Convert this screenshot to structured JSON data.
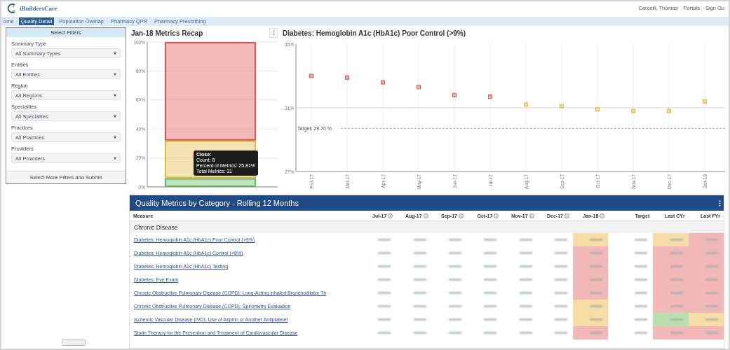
{
  "header": {
    "logo_text": "iBuildersCare",
    "user_links": [
      "Carcelli, Thomas",
      "Portals",
      "Sign Ou"
    ]
  },
  "nav": [
    {
      "label": "ome",
      "selected": false
    },
    {
      "label": "Quality Detail",
      "selected": true
    },
    {
      "label": "Population Overlap",
      "selected": false
    },
    {
      "label": "Pharmacy QPR",
      "selected": false
    },
    {
      "label": "Pharmacy Prescribing",
      "selected": false
    }
  ],
  "filters": {
    "title": "Select Filters",
    "fields": [
      {
        "label": "Summary Type",
        "value": "All Summary Types"
      },
      {
        "label": "Entities",
        "value": "All Entities"
      },
      {
        "label": "Region",
        "value": "All Regions"
      },
      {
        "label": "Specialties",
        "value": "All Specialties"
      },
      {
        "label": "Practices",
        "value": "All Practices"
      },
      {
        "label": "Providers",
        "value": "All Providers"
      }
    ],
    "submit": "Select More Filters and Submit"
  },
  "recap": {
    "title": "Jan-18 Metrics Recap",
    "chart_data": {
      "type": "bar",
      "stacked": true,
      "grid": true,
      "ylim": [
        0,
        100
      ],
      "yticks": [
        {
          "value": 0,
          "label": "0%"
        },
        {
          "value": 20,
          "label": "20%"
        },
        {
          "value": 40,
          "label": "40%"
        },
        {
          "value": 60,
          "label": "60%"
        },
        {
          "value": 80,
          "label": "80%"
        },
        {
          "value": 100,
          "label": "100%"
        }
      ],
      "series": [
        {
          "color": "#5cb85c",
          "values": [
            6
          ]
        },
        {
          "color": "#e6b73c",
          "values": [
            26
          ]
        },
        {
          "color": "#d9534f",
          "values": [
            68
          ]
        }
      ]
    },
    "tooltip": {
      "title": "Close:",
      "lines": [
        "Count: 8",
        "Percent of Metrics: 25.81%",
        "Total Metrics: 31"
      ]
    }
  },
  "trend": {
    "title": "Diabetes: Hemoglobin A1c (HbA1c) Poor Control (>9%)",
    "chart_data": {
      "type": "scatter",
      "grid": "x",
      "categories": [
        "Feb-17",
        "Mar-17",
        "Apr-17",
        "May-17",
        "Jun-17",
        "Jul-17",
        "Aug-17",
        "Sep-17",
        "Oct-17",
        "Nov-17",
        "Dec-17",
        "Jan-18"
      ],
      "ylim": [
        27,
        35
      ],
      "yticks": [
        {
          "value": 27,
          "label": "27%"
        },
        {
          "value": 31,
          "label": "31%"
        },
        {
          "value": 35,
          "label": "35%"
        }
      ],
      "series": [
        {
          "color": "#d9534f",
          "values": [
            33.0,
            32.9,
            32.6,
            32.3,
            31.8,
            31.7,
            null,
            null,
            null,
            null,
            null,
            null
          ]
        },
        {
          "color": "#e6b73c",
          "values": [
            null,
            null,
            null,
            null,
            null,
            null,
            31.2,
            31.1,
            30.9,
            30.8,
            30.8,
            31.4
          ]
        }
      ],
      "ref_lines": [
        {
          "axis": "y",
          "value": 31
        },
        {
          "axis": "y",
          "value": 29.7,
          "label": "Target: 29.70 %"
        }
      ]
    }
  },
  "table": {
    "title": "Quality Metrics by Category - Rolling 12 Months",
    "columns": [
      {
        "label": "Measure",
        "info": false
      },
      {
        "label": "Jul-17",
        "info": true
      },
      {
        "label": "Aug-17",
        "info": true
      },
      {
        "label": "Sep-17",
        "info": true
      },
      {
        "label": "Oct-17",
        "info": true
      },
      {
        "label": "Nov-17",
        "info": true
      },
      {
        "label": "Dec-17",
        "info": true
      },
      {
        "label": "Jan-18",
        "info": true
      },
      {
        "label": "Target",
        "info": false
      },
      {
        "label": "Last CYr",
        "info": false
      },
      {
        "label": "Last FYr",
        "info": false
      }
    ],
    "section": "Chronic Disease",
    "rows": [
      {
        "measure": "Diabetes: Hemoglobin A1c (HbA1c) Poor Control (>9%)",
        "highlights": [
          {
            "color": "#f8dca6"
          },
          {
            "color": "#f8dca6"
          },
          {
            "color": "#f2b8b8"
          }
        ]
      },
      {
        "measure": "Diabetes: Hemoglobin A1c (HbA1c) Control (<8%)",
        "highlights": [
          {
            "color": "#f2b8b8"
          },
          {
            "color": "#f2b8b8"
          },
          {
            "color": "#f2b8b8"
          }
        ]
      },
      {
        "measure": "Diabetes: Hemoglobin A1c (HbA1c) Testing",
        "highlights": [
          {
            "color": "#f2b8b8"
          },
          {
            "color": "#f2b8b8"
          },
          {
            "color": "#f2b8b8"
          }
        ]
      },
      {
        "measure": "Diabetes: Eye Exam",
        "highlights": [
          {
            "color": "#f2b8b8"
          },
          {
            "color": "#f2b8b8"
          },
          {
            "color": "#f2b8b8"
          }
        ]
      },
      {
        "measure": "Chronic Obstructive Pulmonary Disease (COPD): Long-Acting Inhaled Bronchodilator Th",
        "highlights": [
          {
            "color": "#f2b8b8"
          },
          {
            "color": "#f2b8b8"
          },
          {
            "color": "#f2b8b8"
          }
        ]
      },
      {
        "measure": "Chronic Obstructive Pulmonary Disease (COPD): Spirometry Evaluation",
        "highlights": [
          {
            "color": "#f8dca6"
          },
          {
            "color": "#f2b8b8"
          },
          {
            "color": "#f2b8b8"
          }
        ]
      },
      {
        "measure": "Ischemic Vascular Disease (IVD): Use of Aspirin or Another Antiplatelet",
        "highlights": [
          {
            "color": "#f8dca6"
          },
          {
            "color": "#b8deb0"
          },
          {
            "color": "#f8dca6"
          }
        ]
      },
      {
        "measure": "Statin Therapy for the Prevention and Treatment of Cardiovascular Disease",
        "highlights": [
          {
            "color": "#f2b8b8"
          },
          {
            "color": "#f2b8b8"
          },
          {
            "color": "#f2b8b8"
          }
        ]
      }
    ]
  }
}
